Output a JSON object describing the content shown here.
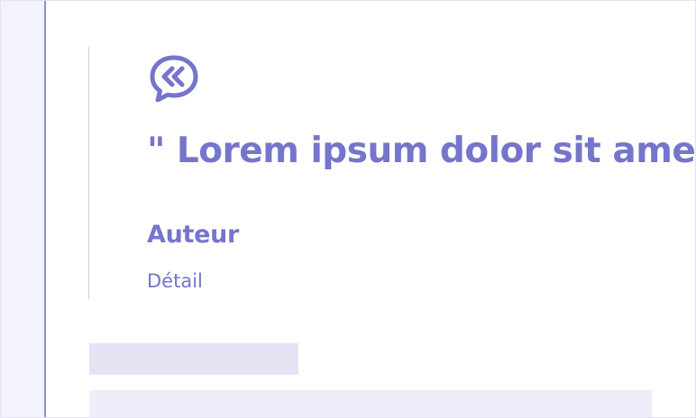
{
  "quote": {
    "icon": "quote-bubble-icon",
    "text": "\" Lorem ipsum dolor sit amet, consectetur adipiscing elit \"",
    "author": "Auteur",
    "detail": "Détail"
  },
  "colors": {
    "accent": "#7575cc",
    "side_panel": "#f3f3fc",
    "side_border": "#8e8ed0",
    "quote_border": "#cfcfcf",
    "skeleton_dark": "#e4e4f4",
    "skeleton_light": "#eeeefb"
  }
}
